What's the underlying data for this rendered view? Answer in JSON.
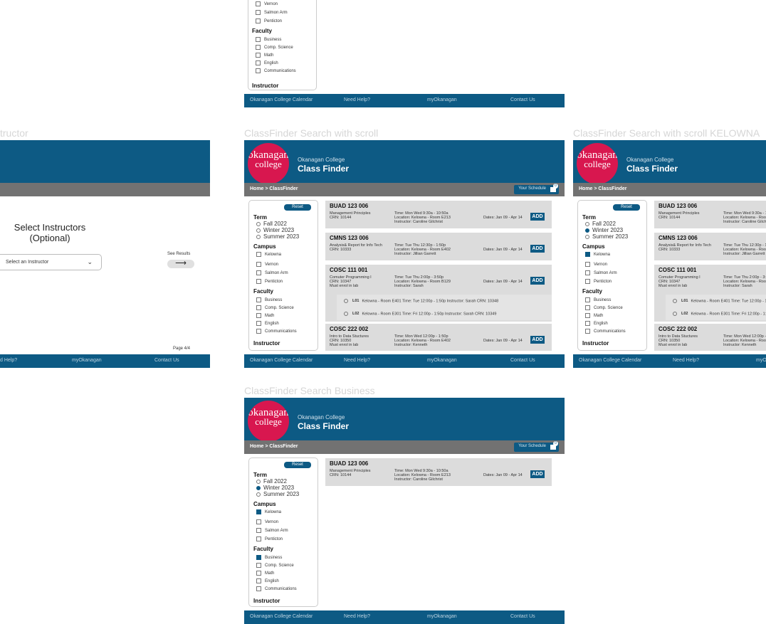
{
  "common": {
    "logo_line1": "okanagan",
    "logo_line2": "college",
    "header_sub": "Okanagan College",
    "header_title": "Class Finder",
    "breadcrumb": "Home > ClassFinder",
    "your_schedule": "Your Schedule",
    "schedule_count": "0",
    "reset": "Reset",
    "term_heading": "Term",
    "terms": [
      "Fall 2022",
      "Winter 2023",
      "Summer 2023"
    ],
    "campus_heading": "Campus",
    "campuses": [
      "Kelowna",
      "Vernon",
      "Salmon Arm",
      "Penticton"
    ],
    "faculty_heading": "Faculty",
    "faculties": [
      "Business",
      "Comp. Science",
      "Math",
      "English",
      "Communications"
    ],
    "instructor_heading": "Instructor",
    "add": "ADD",
    "footer": [
      "Okanagan College Calendar",
      "Need Help?",
      "myOkanagan",
      "Contact Us"
    ]
  },
  "frames": {
    "instructor_label": "tructor",
    "scroll_label": "ClassFinder Search with scroll",
    "scroll_kelowna_label": "ClassFinder Search with scroll KELOWNA",
    "business_label": "ClassFinder Search Business"
  },
  "instructor_page": {
    "title": "Select Instructors (Optional)",
    "select_placeholder": "Select an Instructor",
    "see_results": "See Results",
    "page": "Page 4/4",
    "footer": [
      "d Help?",
      "myOkanagan",
      "Contact Us"
    ]
  },
  "courses": [
    {
      "code": "BUAD 123 006",
      "desc": "Management Principles\nCRN: 10144",
      "meta": "Time: Mon Wed 9:30a - 10:50a\nLocation: Kelowna - Room E213\nInstructor: Caroline Gilchrist",
      "dates": "Dates: Jan 09 - Apr 14"
    },
    {
      "code": "CMNS 123 006",
      "desc": "Analysis& Report for Info Tech\nCRN: 10333",
      "meta": "Time: Tue Thu 12:30p - 1:50p\nLocation: Kelowna - Room E402\nInstructor: Jillian Garrett",
      "dates": "Dates: Jan 09 - Apr 14"
    },
    {
      "code": "COSC 111 001",
      "desc": "Comuter Programming I\nCRN: 10347\nMust enrol in lab",
      "meta": "Time: Tue Thu 2:00p - 3:50p\nLocation: Kelowna - Room B129\nInstructor: Sarah",
      "dates": "Dates: Jan 09 - Apr 14"
    },
    {
      "code": "COSC 222 002",
      "desc": "Intro to Data Stuctures\nCRN: 10350\nMust enrol in lab",
      "meta": "Time: Mon Wed 12:00p - 1:50p\nLocation: Kelowna - Room E402\nInstructor: Kenneth",
      "dates": "Dates: Jan 09 - Apr 14"
    }
  ],
  "labs": [
    {
      "code": "L01",
      "text": "Kelowna - Room E401   Time: Tue 12:00p - 1:50p   Instructor: Sarah   CRN: 10348"
    },
    {
      "code": "L02",
      "text": "Kelowna - Room E301   Time: Fri 12:00p - 1:50p   Instructor: Sarah   CRN: 10349"
    }
  ],
  "colors": {
    "brand": "#0d5a84",
    "logo": "#d8174f",
    "crumb": "#727272"
  }
}
